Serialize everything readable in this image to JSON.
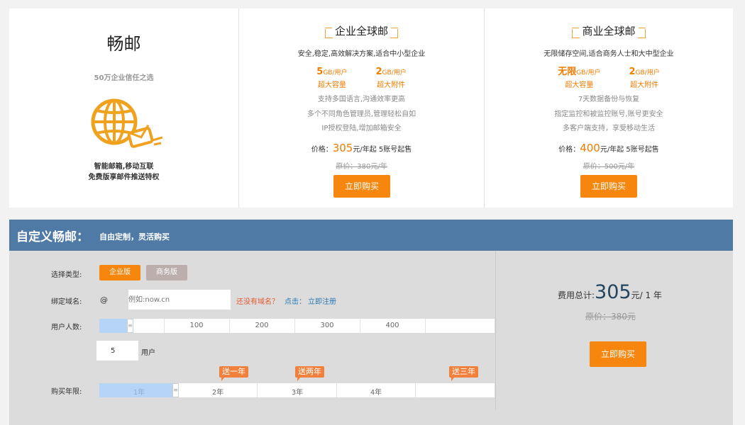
{
  "intro": {
    "brand": "畅邮",
    "slogan": "50万企业信任之选",
    "icon": "globe-mail-icon",
    "features": [
      "智能邮箱,移动互联",
      "免费版享邮件推送特权"
    ]
  },
  "plans": [
    {
      "title": "企业全球邮",
      "desc": "安全,稳定,高效解决方案,适合中小型企业",
      "specs": [
        {
          "value": "5",
          "unit": "GB/用户",
          "sub": "超大容量"
        },
        {
          "value": "2",
          "unit": "GB/用户",
          "sub": "超大附件"
        }
      ],
      "lines": [
        "支持多国语言,沟通效率更高",
        "多个不同角色管理员,管理轻松自如",
        "IP授权登陆,增加邮箱安全"
      ],
      "price_label": "价格：",
      "price": "305",
      "price_suffix": "元/年起 5账号起售",
      "orig": "原价：380元/年",
      "buy": "立即购买"
    },
    {
      "title": "商业全球邮",
      "desc": "无限储存空间,适合商务人士和大中型企业",
      "specs": [
        {
          "value": "无限",
          "unit": "GB/用户",
          "sub": "超大容量"
        },
        {
          "value": "2",
          "unit": "GB/用户",
          "sub": "超大附件"
        }
      ],
      "lines": [
        "7天数据备份与恢复",
        "指定监控和被监控账号,账号更安全",
        "多客户端支持，享受移动生活"
      ],
      "price_label": "价格：",
      "price": "400",
      "price_suffix": "元/年起 5账号起售",
      "orig": "原价：500元/年",
      "buy": "立即购买"
    }
  ],
  "custom": {
    "title": "自定义畅邮：",
    "subtitle": "自由定制，灵活购买",
    "type_label": "选择类型:",
    "types": [
      "企业版",
      "商务版"
    ],
    "selected_type": "企业版",
    "domain_label": "绑定域名:",
    "at": "@",
    "domain_placeholder": "例如:now.cn",
    "no_domain": "还没有域名？",
    "click": "点击：",
    "register": "立即注册",
    "users_label": "用户人数:",
    "users_ticks": [
      "100",
      "200",
      "300",
      "400"
    ],
    "users_value": "5",
    "users_unit": "用户",
    "years_label": "购买年限:",
    "years_ticks": [
      "1年",
      "2年",
      "3年",
      "4年"
    ],
    "bonuses": [
      "送一年",
      "送两年",
      "送三年"
    ],
    "total_label": "费用总计:",
    "total": "305",
    "total_unit": "元/ 1 年",
    "total_orig": "原价：380元",
    "buy": "立即购买",
    "colors": {
      "accent": "#f7860e",
      "header": "#4f7aa6",
      "slider_fill": "#b6d4f5"
    }
  }
}
